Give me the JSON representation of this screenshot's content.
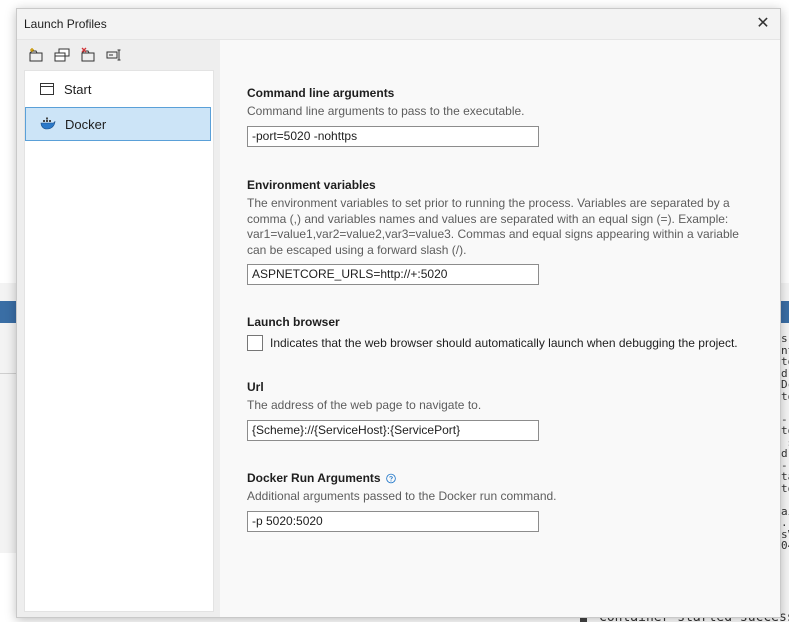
{
  "dialog": {
    "title": "Launch Profiles",
    "close_glyph": "✕"
  },
  "toolbar": {
    "buttons": [
      {
        "name": "new-profile-icon"
      },
      {
        "name": "copy-profile-icon"
      },
      {
        "name": "delete-profile-icon"
      },
      {
        "name": "rename-profile-icon"
      }
    ]
  },
  "profiles": [
    {
      "label": "Start",
      "icon": "window-icon",
      "selected": false
    },
    {
      "label": "Docker",
      "icon": "docker-icon",
      "selected": true
    }
  ],
  "settings": {
    "command_line": {
      "title": "Command line arguments",
      "description": "Command line arguments to pass to the executable.",
      "value": "-port=5020 -nohttps"
    },
    "env_vars": {
      "title": "Environment variables",
      "description_lines": [
        "The environment variables to set prior to running the process. Variables are separated by a",
        "comma (,) and variables names and values are separated with an equal sign (=). Example:",
        "var1=value1,var2=value2,var3=value3. Commas and equal signs appearing within a variable",
        "can be escaped using a forward slash (/)."
      ],
      "value": "ASPNETCORE_URLS=http://+:5020"
    },
    "launch_browser": {
      "title": "Launch browser",
      "checkbox_label": "Indicates that the web browser should automatically launch when debugging the project.",
      "checked": false
    },
    "url": {
      "title": "Url",
      "description": "The address of the web page to navigate to.",
      "value": "{Scheme}://{ServiceHost}:{ServicePort}"
    },
    "docker_run": {
      "title": "Docker Run Arguments",
      "description": "Additional arguments passed to the Docker run command.",
      "value": "-p 5020:5020"
    }
  },
  "background": {
    "code_fragments": [
      "s",
      "nt",
      "to",
      "d.",
      "Dc",
      "to",
      "",
      "-",
      "to",
      " s",
      "d",
      "-",
      "ta",
      "to",
      "",
      "ai",
      ".",
      "sV",
      "04"
    ],
    "bottom_text": "Container started successful"
  }
}
